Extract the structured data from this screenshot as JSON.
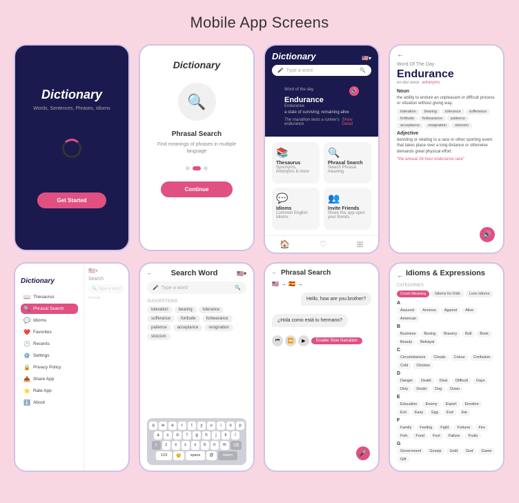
{
  "page": {
    "title": "Mobile App Screens"
  },
  "screens": {
    "splash": {
      "logo": "Dictionary",
      "tagline": "Words, Sentences, Phrases, Idioms",
      "button_label": "Get Started"
    },
    "onboard": {
      "logo": "Dictionary",
      "feature_title": "Phrasal Search",
      "feature_desc": "Find meanings of phrases in multiple language",
      "button_label": "Continue"
    },
    "home": {
      "logo": "Dictionary",
      "search_placeholder": "Type a word",
      "wotd_label": "Word of the day",
      "wotd_word": "Endurance",
      "wotd_phonetic": "Enduranse",
      "wotd_def": "a state of surviving; remaining alive",
      "wotd_example": "The marathon tests a runner's endurance",
      "show_detail": "Show Detail",
      "grid_items": [
        {
          "icon": "📚",
          "label": "Thesaurus",
          "sublabel": "Synonyms, Antonyms & more"
        },
        {
          "icon": "🔍",
          "label": "Phrasal Search",
          "sublabel": "Search Phrasal meaning"
        },
        {
          "icon": "💬",
          "label": "Idioms",
          "sublabel": "Common English Idioms"
        },
        {
          "icon": "👥",
          "label": "Invite Friends",
          "sublabel": "Share this app upon your friends"
        }
      ]
    },
    "word_detail": {
      "back": "←",
      "page_title": "Word Of The Day",
      "word": "Endurance",
      "phonetic": "en-dur-ance",
      "antonyms_label": "antonyms",
      "noun_label": "Noun",
      "noun_def": "the ability to endure an unpleasant or difficult process or situation without giving way.",
      "noun_synonyms": [
        "toleration",
        "bearing",
        "tolerance",
        "sufferance",
        "fortitude",
        "forbearance",
        "patience",
        "acceptance",
        "resignation",
        "stoicism"
      ],
      "adj_label": "Adjective",
      "adj_def": "denoting or relating to a race or other sporting event that takes place over a long distance or otherwise demands great physical effort.",
      "adj_example": "\"the annual 24-hour endurance race\""
    },
    "sidebar": {
      "logo": "Dictionary",
      "items": [
        {
          "icon": "📖",
          "label": "Thesaurus"
        },
        {
          "icon": "🔍",
          "label": "Phrasal Search",
          "active": true
        },
        {
          "icon": "💬",
          "label": "Idioms"
        },
        {
          "icon": "❤️",
          "label": "Favorites"
        },
        {
          "icon": "🕐",
          "label": "Recents"
        },
        {
          "icon": "⚙️",
          "label": "Settings"
        },
        {
          "icon": "🔒",
          "label": "Privacy Policy"
        },
        {
          "icon": "📤",
          "label": "Share App"
        },
        {
          "icon": "⭐",
          "label": "Rate App"
        },
        {
          "icon": "ℹ️",
          "label": "About"
        }
      ]
    },
    "search_word": {
      "back": "←",
      "title": "Search Word",
      "search_placeholder": "Type a word",
      "suggestions_label": "SUGGESTIONS",
      "suggestions": [
        "toleration",
        "bearing",
        "tolerance",
        "sufferance",
        "fortitude",
        "forbearance",
        "patience",
        "acceptance",
        "resignation",
        "stoicism"
      ],
      "keyboard_rows": [
        [
          "q",
          "w",
          "e",
          "r",
          "t",
          "y",
          "u",
          "i",
          "o",
          "p"
        ],
        [
          "a",
          "s",
          "d",
          "f",
          "g",
          "h",
          "j",
          "k",
          "l"
        ],
        [
          "z",
          "x",
          "c",
          "v",
          "b",
          "n",
          "m"
        ]
      ],
      "kb_special": [
        "123",
        "😊",
        "space",
        "@",
        "return"
      ]
    },
    "phrasal_search": {
      "back": "←",
      "title": "Phrasal Search",
      "question_en": "Hello, how are you brother?",
      "question_es": "¿Hola como está tu hermano?",
      "slow_label": "Enable Slow Narration"
    },
    "idioms": {
      "back": "←",
      "title": "Idioms & Expressions",
      "categories_label": "CATEGORIES",
      "categories": [
        "Crush Meaning",
        "Idioms for Kids",
        "Love Idioms"
      ],
      "letters": [
        {
          "letter": "A",
          "idioms": [
            "Assured",
            "Anxious",
            "Against",
            "Alive",
            "American"
          ]
        },
        {
          "letter": "B",
          "idioms": [
            "Business",
            "Boxing",
            "Bravery",
            "Bull",
            "Book",
            "Beauty",
            "Betrayal"
          ]
        },
        {
          "letter": "C",
          "idioms": [
            "Circumstances",
            "Clouds",
            "Colour",
            "Confusion",
            "Cold",
            "Chicken"
          ]
        },
        {
          "letter": "D",
          "idioms": [
            "Danger",
            "Death",
            "Deal",
            "Difficult",
            "Days",
            "Dirty",
            "Doubt",
            "Dog",
            "Down"
          ]
        },
        {
          "letter": "E",
          "idioms": [
            "Education",
            "Enemy",
            "Expert",
            "Emotion",
            "Evil",
            "Easy",
            "Egg",
            "End",
            "Ear"
          ]
        },
        {
          "letter": "F",
          "idioms": [
            "Family",
            "Feeling",
            "Fight",
            "Fortune",
            "Fire",
            "Fish",
            "Food",
            "Fool",
            "Failure",
            "Fruits"
          ]
        },
        {
          "letter": "G",
          "idioms": [
            "Government",
            "Gossip",
            "Gold",
            "God",
            "Game",
            "Gift"
          ]
        }
      ]
    }
  }
}
